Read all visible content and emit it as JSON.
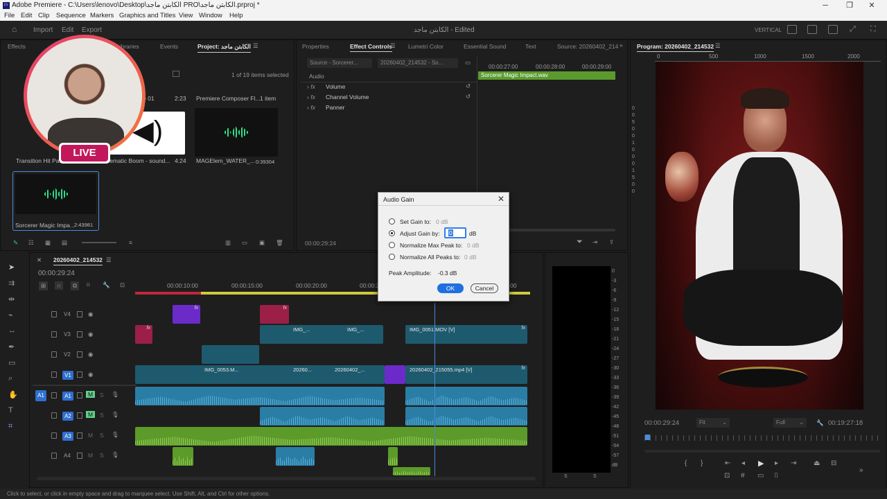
{
  "titlebar": {
    "title": "Adobe Premiere - C:\\Users\\lenovo\\Desktop\\الكابتن ماجد PRO\\الكابتن ماجد.prproj *",
    "minimize": "─",
    "maximize": "❐",
    "close": "✕"
  },
  "menu": [
    "File",
    "Edit",
    "Clip",
    "Sequence",
    "Markers",
    "Graphics and Titles",
    "View",
    "Window",
    "Help"
  ],
  "header": {
    "import": "Import",
    "edit": "Edit",
    "export": "Export",
    "project_title": "الكابتن ماجد - Edited",
    "vertical": "VERTICAL"
  },
  "project_panel": {
    "tabs": [
      "Effects",
      "Libraries",
      "Events",
      "Project: الكابتن ماجد"
    ],
    "items_selected": "1 of 19 items selected",
    "items": [
      {
        "name": "Transition Hit Pa...",
        "duration": ""
      },
      {
        "name": "...ematic Boom - sound...",
        "duration": "4:24"
      },
      {
        "name": "MAGElem_WATER_...",
        "duration": "0:39304"
      },
      {
        "name": "Sorcerer Magic Impa...",
        "duration": "2:43981"
      }
    ],
    "item01_label": "...e 01",
    "item01_duration": "2:23",
    "bin_name": "Premiere Composer Fl...",
    "bin_count": "1 item",
    "live_badge": "LIVE"
  },
  "effect_panel": {
    "tabs": [
      "Properties",
      "Effect Controls",
      "Lumetri Color",
      "Essential Sound",
      "Text",
      "Source: 20260402_214"
    ],
    "source_chip": "Source - Sorcerer...",
    "seq_chip": "20260402_214532 - So...",
    "section": "Audio",
    "effects": [
      "Volume",
      "Channel Volume",
      "Panner"
    ],
    "ruler": [
      "00:00:27:00",
      "00:00:28:00",
      "00:00:29:00"
    ],
    "clip_name": "Sorcerer Magic Impact.wav",
    "timecode": "00:00:29:24"
  },
  "dialog": {
    "title": "Audio Gain",
    "options": [
      {
        "label": "Set Gain to:",
        "value": "0 dB",
        "selected": false
      },
      {
        "label": "Adjust Gain by:",
        "value": "0",
        "unit": "dB",
        "selected": true
      },
      {
        "label": "Normalize Max Peak to:",
        "value": "0 dB",
        "selected": false
      },
      {
        "label": "Normalize All Peaks to:",
        "value": "0 dB",
        "selected": false
      }
    ],
    "peak_label": "Peak Amplitude:",
    "peak_value": "-0.3 dB",
    "ok": "OK",
    "cancel": "Cancel"
  },
  "timeline": {
    "sequence": "20260402_214532",
    "timecode": "00:00:29:24",
    "ruler": [
      "00:00:10:00",
      "00:00:15:00",
      "00:00:20:00",
      "00:00:2",
      "00"
    ],
    "video_tracks": [
      "V4",
      "V3",
      "V2",
      "V1"
    ],
    "audio_tracks": [
      "A1",
      "A2",
      "A3",
      "A4"
    ],
    "clips": {
      "v3_a": "IMG_...",
      "v3_b": "IMG_...",
      "v3_c": "IMG_0051.MOV [V]",
      "v1_a": "IMG_0053.M...",
      "v1_b": "20260...",
      "v1_c": "20260402_...",
      "v1_d": "20260402_215055.mp4 [V]"
    },
    "fx": "fx",
    "m": "M",
    "s": "S"
  },
  "meter": {
    "scale": [
      "0",
      "-3",
      "-6",
      "-9",
      "-12",
      "-15",
      "-18",
      "-21",
      "-24",
      "-27",
      "-30",
      "-33",
      "-36",
      "-39",
      "-42",
      "-45",
      "-48",
      "-51",
      "-54",
      "-57",
      "dB"
    ],
    "left": "S",
    "right": "S"
  },
  "program": {
    "tab": "Program: 20260402_214532",
    "ruler": [
      "0",
      "500",
      "1000",
      "1500",
      "2000"
    ],
    "vruler": [
      "0",
      "0",
      "5",
      "0",
      "0",
      "1",
      "0",
      "0",
      "0",
      "1",
      "5",
      "0",
      "0"
    ],
    "timecode": "00:00:29:24",
    "fit": "Fit",
    "full": "Full",
    "duration": "00:19:27:18"
  },
  "status": "Click to select, or click in empty space and drag to marquee select. Use Shift, Alt, and Ctrl for other options."
}
